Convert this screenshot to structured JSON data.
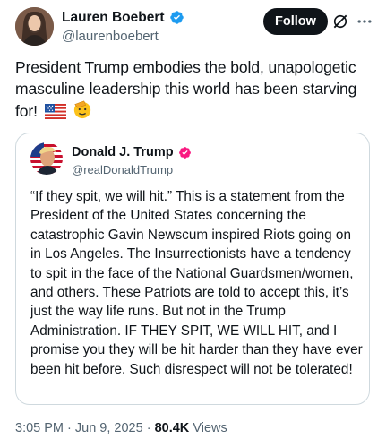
{
  "author": {
    "display_name": "Lauren Boebert",
    "handle": "@laurenboebert",
    "verified_color": "#1d9bf0"
  },
  "actions": {
    "follow_label": "Follow"
  },
  "tweet": {
    "text": "President Trump embodies the bold, unapologetic masculine leadership this world has been starving for!",
    "emojis": [
      "us-flag-emoji",
      "saluting-face-emoji"
    ]
  },
  "quoted": {
    "display_name": "Donald J. Trump",
    "handle": "@realDonaldTrump",
    "verified_color": "#f91880",
    "text": "“If they spit, we will hit.” This is a statement from the President of the United States concerning the catastrophic Gavin Newscum inspired Riots going on in Los Angeles. The Insurrectionists have a tendency to spit in the face of the National Guardsmen/women, and others. These Patriots are told to accept this, it’s just the way life runs. But not in the Trump Administration. IF THEY SPIT, WE WILL HIT, and I promise you they will be hit harder than they have ever been hit before. Such disrespect will not be tolerated!"
  },
  "meta": {
    "time": "3:05 PM",
    "date": "Jun 9, 2025",
    "separator": " · ",
    "views_count": "80.4K",
    "views_label": "Views"
  }
}
